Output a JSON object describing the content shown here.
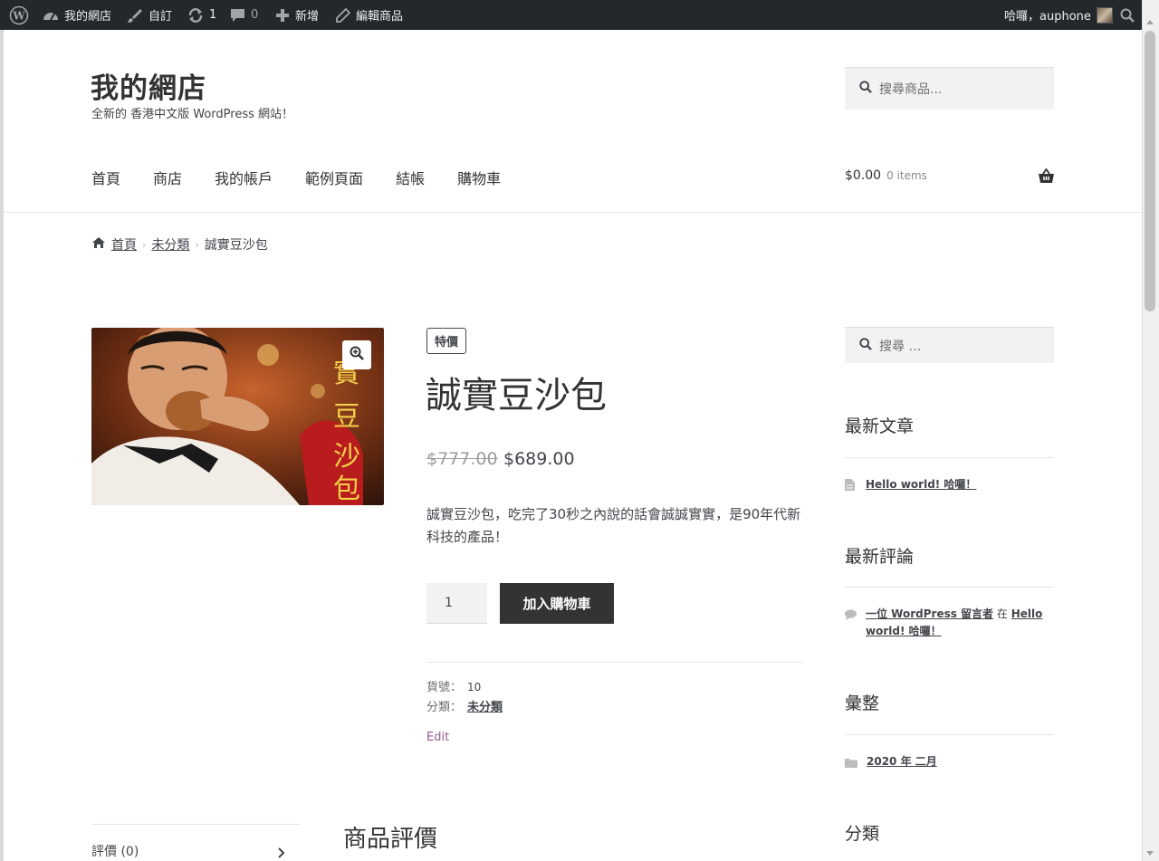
{
  "admin_bar": {
    "site_name": "我的網店",
    "customize": "自訂",
    "updates_count": "1",
    "comments_count": "0",
    "new": "新增",
    "edit_product": "編輯商品",
    "greeting": "哈囉，auphone"
  },
  "site": {
    "title": "我的網店",
    "description": "全新的 香港中文版 WordPress 網站！"
  },
  "header_search": {
    "placeholder": "搜尋商品..."
  },
  "nav": {
    "items": [
      "首頁",
      "商店",
      "我的帳戶",
      "範例頁面",
      "結帳",
      "購物車"
    ]
  },
  "cart": {
    "amount": "$0.00",
    "count": "0 items"
  },
  "breadcrumb": {
    "home": "首頁",
    "category": "未分類",
    "current": "誠實豆沙包"
  },
  "product": {
    "image_caption": "誠實豆沙包",
    "sale_badge": "特價",
    "title": "誠實豆沙包",
    "regular_price": "$777.00",
    "sale_price": "$689.00",
    "short_description": "誠實豆沙包，吃完了30秒之內說的話會誠誠實實，是90年代新科技的產品！",
    "quantity": "1",
    "add_to_cart": "加入購物車",
    "sku_label": "貨號：",
    "sku": "10",
    "category_label": "分類：",
    "category": "未分類",
    "edit": "Edit"
  },
  "tabs": {
    "reviews_tab": "評價 (0)",
    "reviews_heading": "商品評價"
  },
  "sidebar": {
    "search_placeholder": "搜尋 …",
    "recent_posts_title": "最新文章",
    "recent_post": "Hello world! 哈囉！",
    "recent_comments_title": "最新評論",
    "comment_author": "一位 WordPress 留言者",
    "comment_in": "在",
    "comment_post": "Hello world! 哈囉！",
    "archives_title": "彙整",
    "archive_item": "2020 年 二月",
    "categories_title": "分類"
  },
  "colors": {
    "admin_bar": "#23282d",
    "button": "#333333",
    "edit_link": "#96588a"
  },
  "icons": [
    "wordpress-logo-icon",
    "dashboard-icon",
    "brush-icon",
    "refresh-icon",
    "comment-icon",
    "plus-icon",
    "pencil-icon",
    "search-icon",
    "basket-icon",
    "home-icon",
    "zoom-icon",
    "chevron-right-icon",
    "document-icon",
    "folder-icon"
  ]
}
